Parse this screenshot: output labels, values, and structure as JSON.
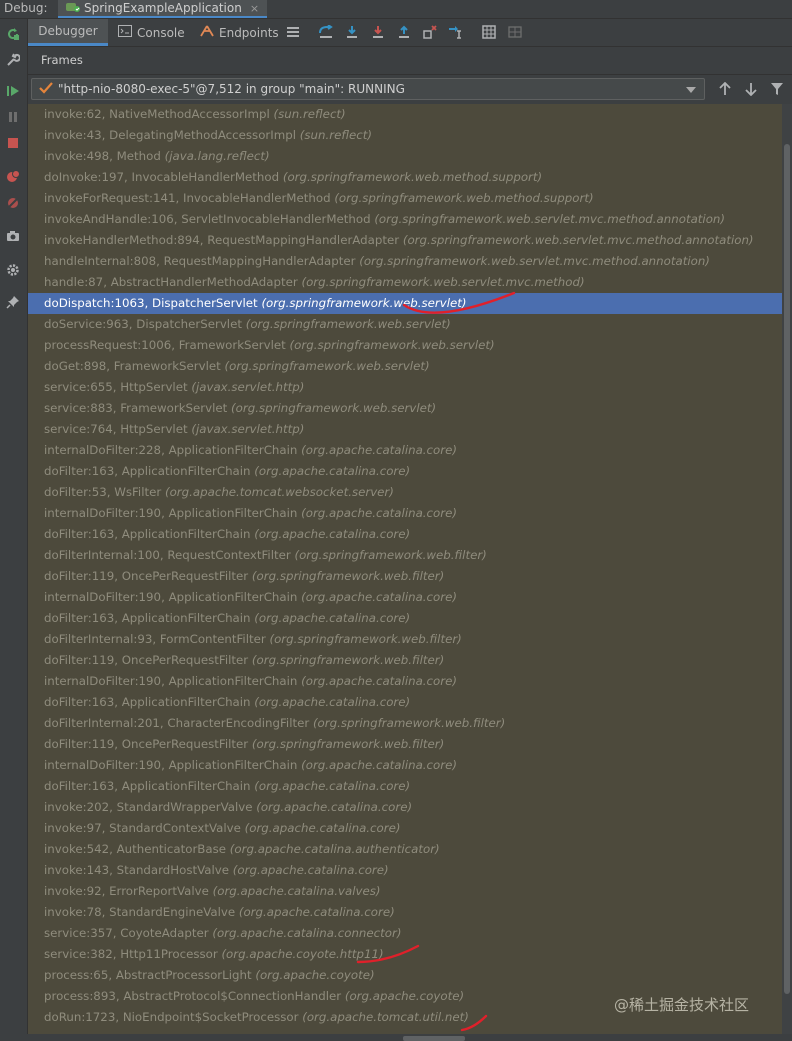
{
  "titlebar": {
    "label": "Debug:",
    "tab_title": "SpringExampleApplication",
    "close_glyph": "×"
  },
  "toolbar": {
    "tabs": [
      {
        "label": "Debugger",
        "icon": "none",
        "active": true
      },
      {
        "label": "Console",
        "icon": "console-icon",
        "active": false
      },
      {
        "label": "Endpoints",
        "icon": "endpoints-icon",
        "active": false
      }
    ],
    "actions": [
      "layout-menu-icon",
      "show-execution-point-icon",
      "step-over-icon",
      "step-into-icon",
      "force-step-into-icon",
      "step-out-icon",
      "drop-frame-icon",
      "run-to-cursor-icon",
      "evaluate-expression-icon",
      "restore-layout-icon"
    ]
  },
  "frames_panel": {
    "title": "Frames",
    "thread_selector": {
      "value": "\"http-nio-8080-exec-5\"@7,512 in group \"main\": RUNNING"
    },
    "actions": [
      "previous-frame-icon",
      "next-frame-icon",
      "filter-icon"
    ]
  },
  "gutter_buttons": [
    "rerun-icon",
    "settings-wrench-icon",
    "resume-icon",
    "pause-icon",
    "stop-icon",
    "view-breakpoints-icon",
    "mute-breakpoints-icon",
    "camera-icon",
    "gear-icon",
    "pin-icon"
  ],
  "frames": [
    {
      "method": "invoke:62, NativeMethodAccessorImpl",
      "pkg": "(sun.reflect)"
    },
    {
      "method": "invoke:43, DelegatingMethodAccessorImpl",
      "pkg": "(sun.reflect)"
    },
    {
      "method": "invoke:498, Method",
      "pkg": "(java.lang.reflect)"
    },
    {
      "method": "doInvoke:197, InvocableHandlerMethod",
      "pkg": "(org.springframework.web.method.support)"
    },
    {
      "method": "invokeForRequest:141, InvocableHandlerMethod",
      "pkg": "(org.springframework.web.method.support)"
    },
    {
      "method": "invokeAndHandle:106, ServletInvocableHandlerMethod",
      "pkg": "(org.springframework.web.servlet.mvc.method.annotation)"
    },
    {
      "method": "invokeHandlerMethod:894, RequestMappingHandlerAdapter",
      "pkg": "(org.springframework.web.servlet.mvc.method.annotation)"
    },
    {
      "method": "handleInternal:808, RequestMappingHandlerAdapter",
      "pkg": "(org.springframework.web.servlet.mvc.method.annotation)"
    },
    {
      "method": "handle:87, AbstractHandlerMethodAdapter",
      "pkg": "(org.springframework.web.servlet.mvc.method)"
    },
    {
      "method": "doDispatch:1063, DispatcherServlet",
      "pkg": "(org.springframework.web.servlet)",
      "selected": true
    },
    {
      "method": "doService:963, DispatcherServlet",
      "pkg": "(org.springframework.web.servlet)"
    },
    {
      "method": "processRequest:1006, FrameworkServlet",
      "pkg": "(org.springframework.web.servlet)"
    },
    {
      "method": "doGet:898, FrameworkServlet",
      "pkg": "(org.springframework.web.servlet)"
    },
    {
      "method": "service:655, HttpServlet",
      "pkg": "(javax.servlet.http)"
    },
    {
      "method": "service:883, FrameworkServlet",
      "pkg": "(org.springframework.web.servlet)"
    },
    {
      "method": "service:764, HttpServlet",
      "pkg": "(javax.servlet.http)"
    },
    {
      "method": "internalDoFilter:228, ApplicationFilterChain",
      "pkg": "(org.apache.catalina.core)"
    },
    {
      "method": "doFilter:163, ApplicationFilterChain",
      "pkg": "(org.apache.catalina.core)"
    },
    {
      "method": "doFilter:53, WsFilter",
      "pkg": "(org.apache.tomcat.websocket.server)"
    },
    {
      "method": "internalDoFilter:190, ApplicationFilterChain",
      "pkg": "(org.apache.catalina.core)"
    },
    {
      "method": "doFilter:163, ApplicationFilterChain",
      "pkg": "(org.apache.catalina.core)"
    },
    {
      "method": "doFilterInternal:100, RequestContextFilter",
      "pkg": "(org.springframework.web.filter)"
    },
    {
      "method": "doFilter:119, OncePerRequestFilter",
      "pkg": "(org.springframework.web.filter)"
    },
    {
      "method": "internalDoFilter:190, ApplicationFilterChain",
      "pkg": "(org.apache.catalina.core)"
    },
    {
      "method": "doFilter:163, ApplicationFilterChain",
      "pkg": "(org.apache.catalina.core)"
    },
    {
      "method": "doFilterInternal:93, FormContentFilter",
      "pkg": "(org.springframework.web.filter)"
    },
    {
      "method": "doFilter:119, OncePerRequestFilter",
      "pkg": "(org.springframework.web.filter)"
    },
    {
      "method": "internalDoFilter:190, ApplicationFilterChain",
      "pkg": "(org.apache.catalina.core)"
    },
    {
      "method": "doFilter:163, ApplicationFilterChain",
      "pkg": "(org.apache.catalina.core)"
    },
    {
      "method": "doFilterInternal:201, CharacterEncodingFilter",
      "pkg": "(org.springframework.web.filter)"
    },
    {
      "method": "doFilter:119, OncePerRequestFilter",
      "pkg": "(org.springframework.web.filter)"
    },
    {
      "method": "internalDoFilter:190, ApplicationFilterChain",
      "pkg": "(org.apache.catalina.core)"
    },
    {
      "method": "doFilter:163, ApplicationFilterChain",
      "pkg": "(org.apache.catalina.core)"
    },
    {
      "method": "invoke:202, StandardWrapperValve",
      "pkg": "(org.apache.catalina.core)"
    },
    {
      "method": "invoke:97, StandardContextValve",
      "pkg": "(org.apache.catalina.core)"
    },
    {
      "method": "invoke:542, AuthenticatorBase",
      "pkg": "(org.apache.catalina.authenticator)"
    },
    {
      "method": "invoke:143, StandardHostValve",
      "pkg": "(org.apache.catalina.core)"
    },
    {
      "method": "invoke:92, ErrorReportValve",
      "pkg": "(org.apache.catalina.valves)"
    },
    {
      "method": "invoke:78, StandardEngineValve",
      "pkg": "(org.apache.catalina.core)"
    },
    {
      "method": "service:357, CoyoteAdapter",
      "pkg": "(org.apache.catalina.connector)"
    },
    {
      "method": "service:382, Http11Processor",
      "pkg": "(org.apache.coyote.http11)"
    },
    {
      "method": "process:65, AbstractProcessorLight",
      "pkg": "(org.apache.coyote)"
    },
    {
      "method": "process:893, AbstractProtocol$ConnectionHandler",
      "pkg": "(org.apache.coyote)"
    },
    {
      "method": "doRun:1723, NioEndpoint$SocketProcessor",
      "pkg": "(org.apache.tomcat.util.net)"
    }
  ],
  "watermark": "@稀土掘金技术社区",
  "colors": {
    "list_background": "#4d4a3c",
    "selection": "#4b6eaf",
    "annotation": "#e0202a",
    "accent": "#4a88c7"
  }
}
